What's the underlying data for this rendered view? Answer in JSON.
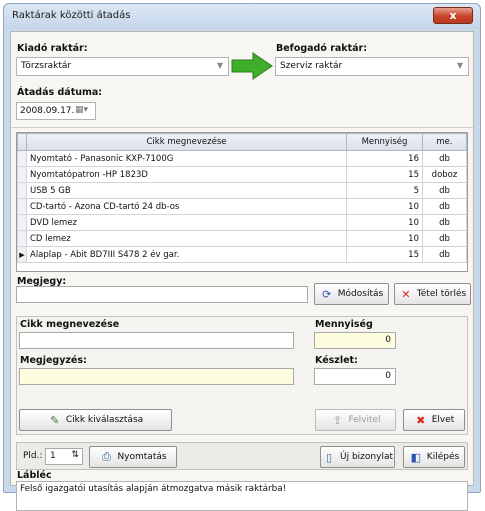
{
  "window": {
    "title": "Raktárak közötti átadás",
    "close_glyph": "x"
  },
  "source": {
    "label": "Kiadó raktár:",
    "value": "Törzsraktár"
  },
  "target": {
    "label": "Befogadó raktár:",
    "value": "Szerviz raktár"
  },
  "transfer_date": {
    "label": "Átadás dátuma:",
    "value": "2008.09.17."
  },
  "grid": {
    "columns": [
      "Cikk megnevezése",
      "Mennyiség",
      "me."
    ],
    "rows": [
      {
        "name": "Nyomtató -  Panasonic KXP-7100G",
        "qty": "16",
        "unit": "db",
        "current": false
      },
      {
        "name": "Nyomtatópatron -HP 1823D",
        "qty": "15",
        "unit": "doboz",
        "current": false
      },
      {
        "name": "USB 5 GB",
        "qty": "5",
        "unit": "db",
        "current": false
      },
      {
        "name": "CD-tartó - Azona CD-tartó 24 db-os",
        "qty": "10",
        "unit": "db",
        "current": false
      },
      {
        "name": "DVD lemez",
        "qty": "10",
        "unit": "db",
        "current": false
      },
      {
        "name": "CD lemez",
        "qty": "10",
        "unit": "db",
        "current": false
      },
      {
        "name": "Alaplap - Abit BD7III  S478  2 év gar.",
        "qty": "15",
        "unit": "db",
        "current": true
      }
    ]
  },
  "note": {
    "label": "Megjegy:",
    "value": ""
  },
  "buttons": {
    "modify": "Módosítás",
    "delete_item": "Tétel törlés",
    "choose_item": "Cikk kiválasztása",
    "record": "Felvitel",
    "discard": "Elvet",
    "print": "Nyomtatás",
    "new_doc": "Új bizonylat",
    "exit": "Kilépés"
  },
  "item_form": {
    "name_label": "Cikk megnevezése",
    "name_value": "",
    "qty_label": "Mennyiség",
    "qty_value": "0",
    "remark_label": "Megjegyzés:",
    "remark_value": "",
    "stock_label": "Készlet:",
    "stock_value": "0"
  },
  "print": {
    "copies_label": "Pld.:",
    "copies_value": "1"
  },
  "footer": {
    "label": "Lábléc",
    "text": "Felső igazgatói utasítás alapján átmozgatva másik raktárba!"
  },
  "colors": {
    "arrow": "#3fae2a",
    "delete_red": "#d42a1f",
    "yellow_field": "#fdfde0"
  }
}
